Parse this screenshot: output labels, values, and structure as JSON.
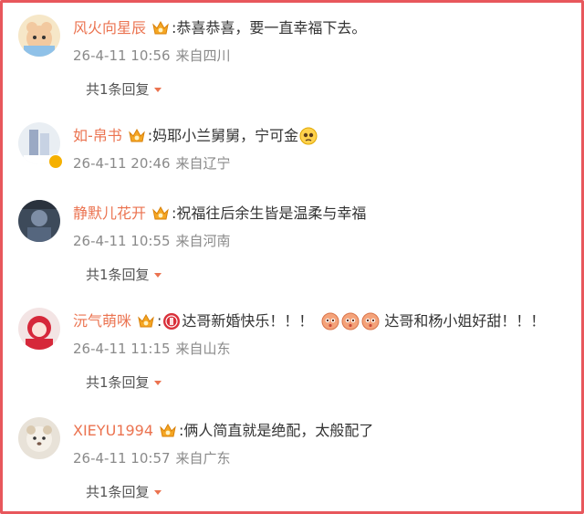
{
  "colors": {
    "frame_border": "#e8575c",
    "username": "#eb7350",
    "meta_text": "#8a8a8a",
    "reply_text": "#555555"
  },
  "comments": [
    {
      "username": "风火向星辰",
      "colon": ":",
      "text": "恭喜恭喜，要一直幸福下去。",
      "time": "26-4-11 10:56",
      "location": "来自四川",
      "replies_label": "共1条回复"
    },
    {
      "username": "如-帛书",
      "colon": ":",
      "text": "妈耶小兰舅舅，宁可金",
      "emoji_icon": "pleading-face-emoji-icon",
      "time": "26-4-11 20:46",
      "location": "来自辽宁"
    },
    {
      "username": "静默儿花开",
      "colon": ":",
      "text": "祝福往后余生皆是温柔与幸福",
      "time": "26-4-11 10:55",
      "location": "来自河南",
      "replies_label": "共1条回复"
    },
    {
      "username": "沅气萌咪",
      "colon": ":",
      "text_a": "达哥新婚快乐！！！",
      "text_b": "达哥和杨小姐好甜！！！",
      "time": "26-4-11 11:15",
      "location": "来自山东",
      "replies_label": "共1条回复"
    },
    {
      "username": "XIEYU1994",
      "colon": ":",
      "text": "俩人简直就是绝配，太般配了",
      "time": "26-4-11 10:57",
      "location": "来自广东",
      "replies_label": "共1条回复"
    }
  ]
}
